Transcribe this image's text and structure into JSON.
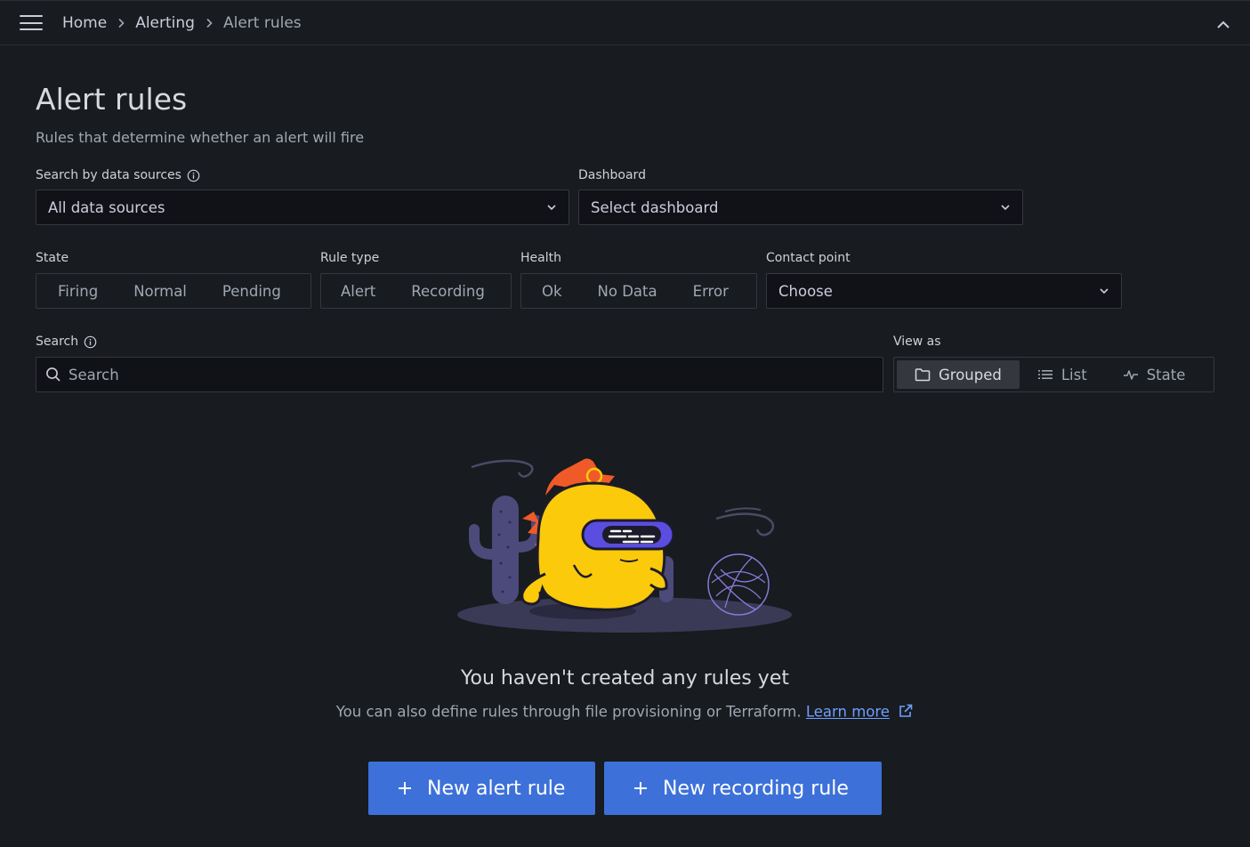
{
  "breadcrumb": {
    "items": [
      "Home",
      "Alerting",
      "Alert rules"
    ]
  },
  "page": {
    "title": "Alert rules",
    "subtitle": "Rules that determine whether an alert will fire"
  },
  "filters": {
    "datasource": {
      "label": "Search by data sources",
      "value": "All data sources"
    },
    "dashboard": {
      "label": "Dashboard",
      "value": "Select dashboard"
    },
    "state": {
      "label": "State",
      "options": [
        "Firing",
        "Normal",
        "Pending"
      ]
    },
    "rule_type": {
      "label": "Rule type",
      "options": [
        "Alert",
        "Recording"
      ]
    },
    "health": {
      "label": "Health",
      "options": [
        "Ok",
        "No Data",
        "Error"
      ]
    },
    "contact_point": {
      "label": "Contact point",
      "value": "Choose"
    },
    "search": {
      "label": "Search",
      "placeholder": "Search"
    },
    "view_as": {
      "label": "View as",
      "options": [
        "Grouped",
        "List",
        "State"
      ],
      "selected": "Grouped"
    }
  },
  "empty_state": {
    "title": "You haven't created any rules yet",
    "text": "You can also define rules through file provisioning or Terraform.",
    "link": "Learn more"
  },
  "actions": {
    "new_alert_rule": "New alert rule",
    "new_recording_rule": "New recording rule"
  },
  "colors": {
    "background": "#181b1f",
    "input_bg": "#111217",
    "border": "#34373d",
    "primary_button": "#3d71d9",
    "link": "#6e9fff"
  }
}
